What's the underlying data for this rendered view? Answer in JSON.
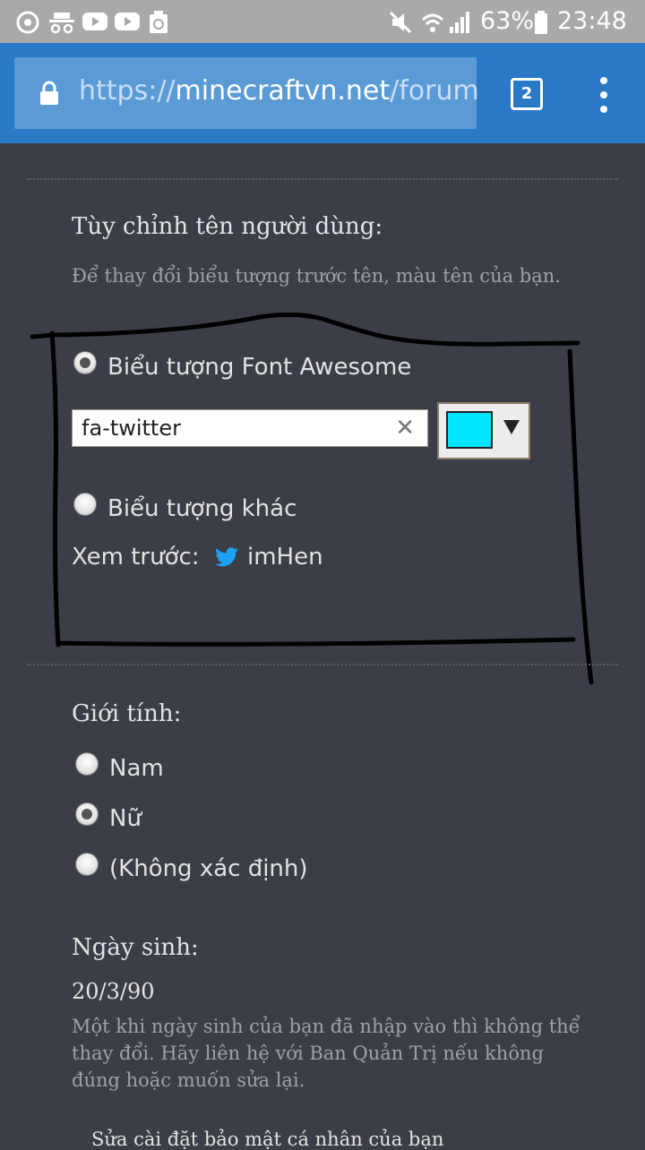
{
  "status_bar": {
    "battery": "63%",
    "time": "23:48",
    "icons": [
      "chrome-icon",
      "incognito-icon",
      "youtube-icon",
      "youtube-icon",
      "recycle-icon",
      "mute-icon",
      "wifi-icon",
      "signal-icon",
      "battery-icon"
    ]
  },
  "browser": {
    "url_scheme": "https://",
    "url_host": "minecraftvn.net",
    "url_path": "/forum",
    "tab_count": "2"
  },
  "custom_name": {
    "heading": "Tùy chỉnh tên người dùng:",
    "hint": "Để thay đổi biểu tượng trước tên, màu tên của bạn.",
    "option_font_awesome": "Biểu tượng Font Awesome",
    "icon_input_value": "fa-twitter",
    "clear_symbol": "✕",
    "color_value": "#00e5ff",
    "option_other": "Biểu tượng khác",
    "preview_label": "Xem trước:",
    "preview_name": "imHen",
    "preview_icon": "twitter-icon",
    "selected_option": "font_awesome"
  },
  "gender": {
    "heading": "Giới tính:",
    "options": [
      "Nam",
      "Nữ",
      "(Không xác định)"
    ],
    "selected": "Nữ"
  },
  "birthday": {
    "heading": "Ngày sinh:",
    "value": "20/3/90",
    "note": "Một khi ngày sinh của bạn đã nhập vào thì không thể thay đổi. Hãy liên hệ với Ban Quản Trị nếu không đúng hoặc muốn sửa lại."
  },
  "footer_link": "Sửa cài đặt bảo mật cá nhân của bạn"
}
